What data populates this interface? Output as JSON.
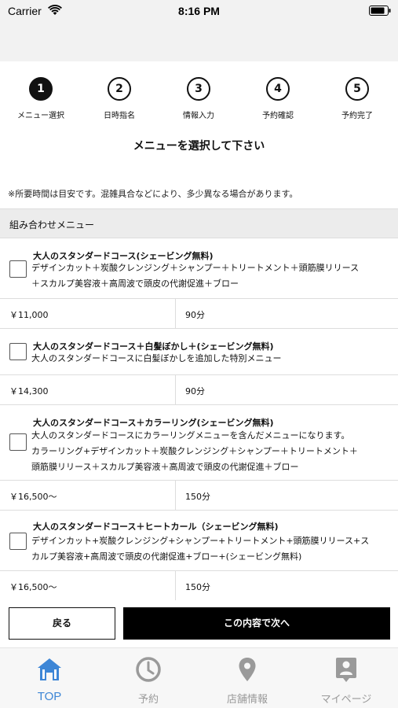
{
  "status_bar": {
    "carrier": "Carrier",
    "time": "8:16 PM"
  },
  "steps": [
    {
      "number": "1",
      "label": "メニュー選択",
      "active": true
    },
    {
      "number": "2",
      "label": "日時指名",
      "active": false
    },
    {
      "number": "3",
      "label": "情報入力",
      "active": false
    },
    {
      "number": "4",
      "label": "予約確認",
      "active": false
    },
    {
      "number": "5",
      "label": "予約完了",
      "active": false
    }
  ],
  "page_title": "メニューを選択して下さい",
  "notice": "※所要時間は目安です。混雑具合などにより、多少異なる場合があります。",
  "section_title": "組み合わせメニュー",
  "menus": [
    {
      "name": "大人のスタンダードコース(シェービング無料)",
      "description": [
        "デザインカット＋炭酸クレンジング＋シャンプー＋トリートメント＋頭筋膜リリース",
        "＋スカルプ美容液＋高周波で頭皮の代謝促進＋ブロー"
      ],
      "price": "￥11,000",
      "duration": "90分",
      "checked": false
    },
    {
      "name": "大人のスタンダードコース＋白髪ぼかし＋(シェービング無料)",
      "description": [
        "大人のスタンダードコースに白髪ぼかしを追加した特別メニュー"
      ],
      "price": "￥14,300",
      "duration": "90分",
      "checked": false
    },
    {
      "name": "大人のスタンダードコース＋カラーリング(シェービング無料)",
      "description": [
        "大人のスタンダードコースにカラーリングメニューを含んだメニューになります。",
        "カラーリング+デザインカット＋炭酸クレンジング＋シャンプー＋トリートメント＋",
        "頭筋膜リリース＋スカルプ美容液＋高周波で頭皮の代謝促進＋ブロー"
      ],
      "price": "￥16,500〜",
      "duration": "150分",
      "checked": false
    },
    {
      "name": "大人のスタンダードコース＋ヒートカール（シェービング無料)",
      "description": [
        "デザインカット+炭酸クレンジング+シャンプー+トリートメント+頭筋膜リリース+ス",
        "カルプ美容液+高周波で頭皮の代謝促進+ブロー+(シェービング無料)"
      ],
      "price": "￥16,500〜",
      "duration": "150分",
      "checked": false
    }
  ],
  "actions": {
    "back": "戻る",
    "next": "この内容で次へ"
  },
  "tabs": [
    {
      "label": "TOP",
      "icon": "home-icon",
      "active": true
    },
    {
      "label": "予約",
      "icon": "clock-icon",
      "active": false
    },
    {
      "label": "店舗情報",
      "icon": "map-pin-icon",
      "active": false
    },
    {
      "label": "マイページ",
      "icon": "profile-card-icon",
      "active": false
    }
  ],
  "colors": {
    "accent": "#3d86d6",
    "primary_button": "#000000",
    "section_bg": "#ececec"
  }
}
